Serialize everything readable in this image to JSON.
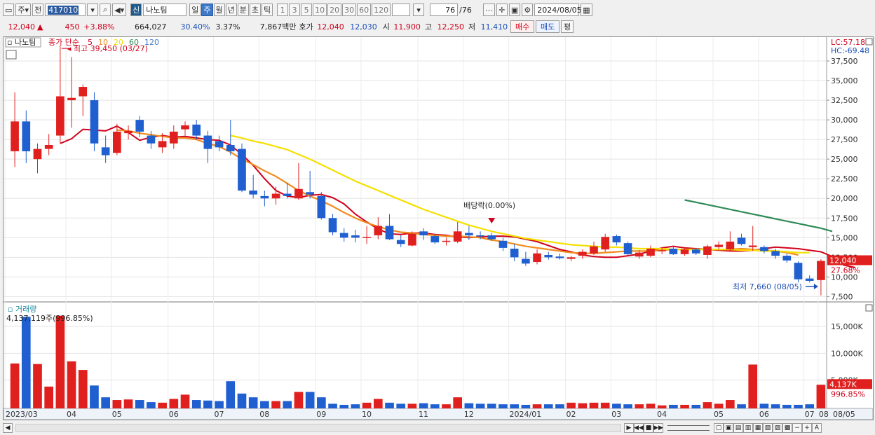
{
  "toolbar": {
    "market": "주",
    "prev_label": "전",
    "code": "417010",
    "stock_badge": "신",
    "stock_name": "나노팀",
    "periods": [
      "일",
      "주",
      "월",
      "년",
      "분",
      "초",
      "틱"
    ],
    "active_period": "주",
    "intervals": [
      "1",
      "3",
      "5",
      "10",
      "20",
      "30",
      "60",
      "120"
    ],
    "count": "76",
    "total": "/76",
    "date": "2024/08/05"
  },
  "quote": {
    "price": "12,040",
    "arrow": "▲",
    "change": "450",
    "change_pct": "+3.88%",
    "volume": "664,027",
    "ratio": "30.40%",
    "turnover": "3.37%",
    "amount": "7,867백만",
    "bid_label": "호가",
    "ask": "12,040",
    "bid": "12,030",
    "open_label": "시",
    "open": "11,900",
    "high_label": "고",
    "high": "12,250",
    "low_label": "저",
    "low": "11,410",
    "buy_btn": "매수",
    "sell_btn": "매도",
    "eval_btn": "평"
  },
  "price_panel": {
    "name_tag": "나노팀",
    "legend_title": "종가 단순",
    "ma_labels": [
      {
        "label": "5",
        "color": "#d0021b"
      },
      {
        "label": "10",
        "color": "#f08c1e"
      },
      {
        "label": "20",
        "color": "#f5e000"
      },
      {
        "label": "60",
        "color": "#2e8b57"
      },
      {
        "label": "120",
        "color": "#4a78c8"
      }
    ],
    "high_marker": "최고 39,450 (03/27)",
    "low_marker": "최저 7,660 (08/05)",
    "dividend_marker": "배당락(0.00%)",
    "lc": "LC:57.18",
    "hc": "HC:-69.48",
    "current_tag": "12,040",
    "current_pct": "27.68%"
  },
  "volume_panel": {
    "title": "거래량",
    "info": "4,137,119주(996.85%)",
    "current_tag": "4,137K",
    "current_pct": "996.85%"
  },
  "chart_data": {
    "type": "candlestick",
    "y_axis": {
      "min": 7000,
      "max": 40000,
      "ticks": [
        "7,500",
        "10,000",
        "12,500",
        "15,000",
        "17,500",
        "20,000",
        "22,500",
        "25,000",
        "27,500",
        "30,000",
        "32,500",
        "35,000",
        "37,500"
      ]
    },
    "volume_axis": {
      "max": 18000000,
      "ticks": [
        "5,000K",
        "10,000K",
        "15,000K"
      ]
    },
    "x_labels": [
      "2023/03",
      "04",
      "05",
      "06",
      "07",
      "08",
      "09",
      "10",
      "11",
      "12",
      "2024/01",
      "02",
      "03",
      "04",
      "05",
      "06",
      "07",
      "08",
      "08/05"
    ],
    "candles": [
      {
        "o": 26000,
        "h": 33500,
        "l": 24000,
        "c": 29800,
        "v": 8100000
      },
      {
        "o": 29800,
        "h": 31200,
        "l": 24500,
        "c": 26000,
        "v": 16800000
      },
      {
        "o": 25000,
        "h": 27000,
        "l": 23200,
        "c": 26300,
        "v": 8000000
      },
      {
        "o": 26300,
        "h": 28200,
        "l": 25500,
        "c": 26800,
        "v": 3800000
      },
      {
        "o": 28000,
        "h": 39450,
        "l": 27000,
        "c": 33000,
        "v": 17000000
      },
      {
        "o": 32500,
        "h": 38000,
        "l": 29000,
        "c": 32800,
        "v": 8500000
      },
      {
        "o": 33000,
        "h": 34500,
        "l": 30500,
        "c": 34200,
        "v": 6900000
      },
      {
        "o": 32500,
        "h": 33500,
        "l": 26000,
        "c": 27000,
        "v": 4000000
      },
      {
        "o": 26500,
        "h": 28000,
        "l": 24500,
        "c": 25500,
        "v": 1800000
      },
      {
        "o": 25800,
        "h": 29500,
        "l": 25500,
        "c": 28500,
        "v": 1300000
      },
      {
        "o": 28300,
        "h": 29300,
        "l": 27500,
        "c": 28600,
        "v": 1400000
      },
      {
        "o": 30000,
        "h": 30500,
        "l": 27800,
        "c": 28500,
        "v": 1300000
      },
      {
        "o": 28000,
        "h": 28600,
        "l": 26300,
        "c": 27000,
        "v": 900000
      },
      {
        "o": 26500,
        "h": 28300,
        "l": 25800,
        "c": 27300,
        "v": 800000
      },
      {
        "o": 27000,
        "h": 29300,
        "l": 26300,
        "c": 28500,
        "v": 1500000
      },
      {
        "o": 28800,
        "h": 29800,
        "l": 28000,
        "c": 29300,
        "v": 2300000
      },
      {
        "o": 29400,
        "h": 30000,
        "l": 27500,
        "c": 28000,
        "v": 1300000
      },
      {
        "o": 28000,
        "h": 28600,
        "l": 24500,
        "c": 26300,
        "v": 1200000
      },
      {
        "o": 27300,
        "h": 28000,
        "l": 26000,
        "c": 26500,
        "v": 1100000
      },
      {
        "o": 26800,
        "h": 30000,
        "l": 25500,
        "c": 26000,
        "v": 4800000
      },
      {
        "o": 26300,
        "h": 27000,
        "l": 20800,
        "c": 21000,
        "v": 2500000
      },
      {
        "o": 21000,
        "h": 23000,
        "l": 20000,
        "c": 20500,
        "v": 1800000
      },
      {
        "o": 20300,
        "h": 21000,
        "l": 19000,
        "c": 20000,
        "v": 1100000
      },
      {
        "o": 20000,
        "h": 21500,
        "l": 19200,
        "c": 20600,
        "v": 1100000
      },
      {
        "o": 20600,
        "h": 22000,
        "l": 20000,
        "c": 20300,
        "v": 1100000
      },
      {
        "o": 20000,
        "h": 24500,
        "l": 19800,
        "c": 21200,
        "v": 2800000
      },
      {
        "o": 20800,
        "h": 23500,
        "l": 20000,
        "c": 20500,
        "v": 2800000
      },
      {
        "o": 20300,
        "h": 20800,
        "l": 17300,
        "c": 17500,
        "v": 1800000
      },
      {
        "o": 17500,
        "h": 18000,
        "l": 15300,
        "c": 15700,
        "v": 600000
      },
      {
        "o": 15600,
        "h": 16200,
        "l": 14500,
        "c": 15000,
        "v": 400000
      },
      {
        "o": 15300,
        "h": 16000,
        "l": 14400,
        "c": 15000,
        "v": 500000
      },
      {
        "o": 15000,
        "h": 16500,
        "l": 14200,
        "c": 15100,
        "v": 800000
      },
      {
        "o": 15300,
        "h": 17600,
        "l": 14800,
        "c": 16500,
        "v": 1500000
      },
      {
        "o": 16500,
        "h": 18000,
        "l": 14700,
        "c": 14800,
        "v": 800000
      },
      {
        "o": 14700,
        "h": 15300,
        "l": 13800,
        "c": 14200,
        "v": 600000
      },
      {
        "o": 14000,
        "h": 15800,
        "l": 13900,
        "c": 15500,
        "v": 600000
      },
      {
        "o": 15800,
        "h": 16200,
        "l": 14700,
        "c": 15300,
        "v": 700000
      },
      {
        "o": 15200,
        "h": 15400,
        "l": 14200,
        "c": 14400,
        "v": 500000
      },
      {
        "o": 14500,
        "h": 15000,
        "l": 14000,
        "c": 14600,
        "v": 500000
      },
      {
        "o": 14500,
        "h": 17000,
        "l": 14300,
        "c": 15800,
        "v": 1800000
      },
      {
        "o": 15600,
        "h": 16500,
        "l": 14700,
        "c": 15300,
        "v": 700000
      },
      {
        "o": 15300,
        "h": 15800,
        "l": 14800,
        "c": 15200,
        "v": 600000
      },
      {
        "o": 15300,
        "h": 15600,
        "l": 14600,
        "c": 14800,
        "v": 600000
      },
      {
        "o": 14600,
        "h": 15000,
        "l": 13300,
        "c": 13700,
        "v": 500000
      },
      {
        "o": 13600,
        "h": 14200,
        "l": 12000,
        "c": 12500,
        "v": 500000
      },
      {
        "o": 12300,
        "h": 13200,
        "l": 11400,
        "c": 11700,
        "v": 400000
      },
      {
        "o": 11900,
        "h": 13500,
        "l": 11600,
        "c": 13000,
        "v": 500000
      },
      {
        "o": 12800,
        "h": 13200,
        "l": 12200,
        "c": 12500,
        "v": 500000
      },
      {
        "o": 12600,
        "h": 13000,
        "l": 12200,
        "c": 12400,
        "v": 500000
      },
      {
        "o": 12300,
        "h": 12700,
        "l": 12000,
        "c": 12500,
        "v": 800000
      },
      {
        "o": 12700,
        "h": 13500,
        "l": 12300,
        "c": 13200,
        "v": 700000
      },
      {
        "o": 13000,
        "h": 14500,
        "l": 12800,
        "c": 13900,
        "v": 800000
      },
      {
        "o": 13500,
        "h": 15500,
        "l": 13200,
        "c": 15100,
        "v": 800000
      },
      {
        "o": 15200,
        "h": 15400,
        "l": 14000,
        "c": 14400,
        "v": 600000
      },
      {
        "o": 14300,
        "h": 14500,
        "l": 12700,
        "c": 12900,
        "v": 500000
      },
      {
        "o": 12600,
        "h": 13400,
        "l": 12300,
        "c": 13100,
        "v": 500000
      },
      {
        "o": 12700,
        "h": 14000,
        "l": 12500,
        "c": 13600,
        "v": 600000
      },
      {
        "o": 13300,
        "h": 13800,
        "l": 12900,
        "c": 13400,
        "v": 300000
      },
      {
        "o": 13600,
        "h": 13800,
        "l": 12800,
        "c": 12900,
        "v": 400000
      },
      {
        "o": 12900,
        "h": 13600,
        "l": 12700,
        "c": 13500,
        "v": 400000
      },
      {
        "o": 13500,
        "h": 13700,
        "l": 12800,
        "c": 13000,
        "v": 400000
      },
      {
        "o": 12800,
        "h": 14100,
        "l": 12300,
        "c": 13900,
        "v": 900000
      },
      {
        "o": 13800,
        "h": 14500,
        "l": 13500,
        "c": 14100,
        "v": 600000
      },
      {
        "o": 13500,
        "h": 15800,
        "l": 13300,
        "c": 14500,
        "v": 1300000
      },
      {
        "o": 15000,
        "h": 15500,
        "l": 14000,
        "c": 14200,
        "v": 500000
      },
      {
        "o": 13800,
        "h": 16500,
        "l": 13300,
        "c": 14000,
        "v": 7900000
      },
      {
        "o": 13800,
        "h": 14000,
        "l": 13000,
        "c": 13300,
        "v": 600000
      },
      {
        "o": 13300,
        "h": 13600,
        "l": 12300,
        "c": 12700,
        "v": 500000
      },
      {
        "o": 12700,
        "h": 13000,
        "l": 11800,
        "c": 12100,
        "v": 400000
      },
      {
        "o": 11800,
        "h": 12000,
        "l": 9300,
        "c": 9700,
        "v": 400000
      },
      {
        "o": 9800,
        "h": 10200,
        "l": 9300,
        "c": 9500,
        "v": 500000
      },
      {
        "o": 9600,
        "h": 12250,
        "l": 7660,
        "c": 12040,
        "v": 4137119
      }
    ],
    "ma_series": [
      {
        "name": "5",
        "color": "#d0021b",
        "start": 4,
        "values": [
          27000,
          27600,
          28800,
          28700,
          28600,
          29200,
          28400,
          27400,
          27800,
          28000,
          27800,
          27900,
          27700,
          27500,
          27400,
          26800,
          25600,
          24200,
          22500,
          21000,
          20300,
          20100,
          20400,
          20500,
          20100,
          19300,
          18000,
          17000,
          16100,
          15500,
          15400,
          15600,
          15600,
          15400,
          15300,
          15100,
          15000,
          15100,
          15200,
          15200,
          15100,
          14800,
          14500,
          14000,
          13500,
          13200,
          12800,
          12600,
          12500,
          12500,
          12700,
          12900,
          13300,
          13700,
          13900,
          13700,
          13600,
          13500,
          13400,
          13300,
          13300,
          13400,
          13600,
          13800,
          13700,
          13600,
          13400,
          13200,
          12600,
          11500,
          11200
        ]
      },
      {
        "name": "10",
        "color": "#f08c1e",
        "start": 9,
        "values": [
          28700,
          28600,
          28300,
          28100,
          27900,
          27700,
          27700,
          27500,
          27000,
          26600,
          25900,
          25000,
          24300,
          23500,
          22800,
          21900,
          21000,
          20300,
          19700,
          19000,
          18200,
          17500,
          16900,
          16400,
          16000,
          15700,
          15600,
          15400,
          15300,
          15200,
          15200,
          15100,
          15000,
          14700,
          14500,
          14200,
          13900,
          13700,
          13500,
          13300,
          13100,
          13000,
          13000,
          13100,
          13200,
          13300,
          13300,
          13300,
          13400,
          13500,
          13500,
          13500,
          13500,
          13500,
          13500,
          13600,
          13500,
          13400,
          13300,
          13100,
          12800
        ]
      },
      {
        "name": "20",
        "color": "#f5e000",
        "start": 19,
        "values": [
          28000,
          27700,
          27300,
          27000,
          26600,
          26200,
          25600,
          25000,
          24300,
          23600,
          22900,
          22200,
          21600,
          21000,
          20400,
          19800,
          19200,
          18600,
          18100,
          17600,
          17100,
          16600,
          16200,
          15800,
          15500,
          15200,
          14900,
          14700,
          14500,
          14300,
          14100,
          14000,
          13900,
          13800,
          13800,
          13700,
          13600,
          13600,
          13600,
          13500,
          13500,
          13500,
          13500,
          13500,
          13500,
          13400,
          13400,
          13300,
          13300,
          13200,
          13100,
          13100
        ]
      },
      {
        "name": "60",
        "color": "#2e8b57",
        "start": 59,
        "values": [
          19800,
          19500,
          19200,
          18900,
          18600,
          18300,
          18000,
          17700,
          17400,
          17100,
          16800,
          16500,
          16200,
          15800
        ]
      }
    ]
  }
}
